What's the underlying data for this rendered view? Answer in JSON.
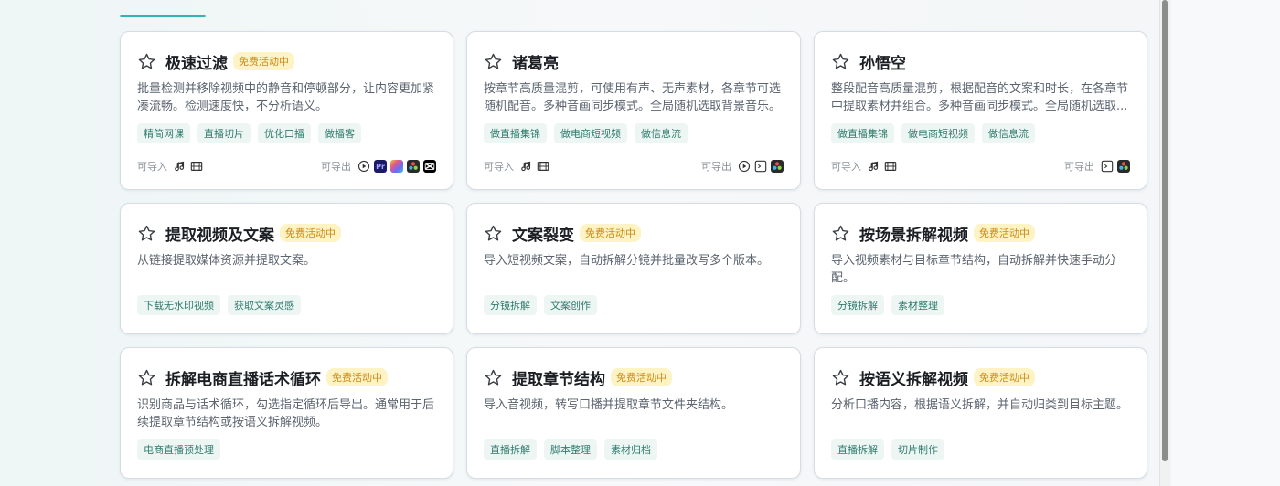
{
  "cards": [
    {
      "title": "极速过滤",
      "badge": "免费活动中",
      "desc": "批量检测并移除视频中的静音和停顿部分，让内容更加紧凑流畅。检测速度快，不分析语义。",
      "tags": [
        "精简网课",
        "直播切片",
        "优化口播",
        "做播客"
      ],
      "import_label": "可导入",
      "export_label": "可导出",
      "import_icons": [
        "music-note-icon",
        "film-icon"
      ],
      "export_icons": [
        "play-circle-icon",
        "premiere-pro-icon",
        "final-cut-icon",
        "davinci-resolve-icon",
        "capcut-icon"
      ]
    },
    {
      "title": "诸葛亮",
      "badge": "",
      "desc": "按章节高质量混剪，可使用有声、无声素材，各章节可选随机配音。多种音画同步模式。全局随机选取背景音乐。",
      "tags": [
        "做直播集锦",
        "做电商短视频",
        "做信息流"
      ],
      "import_label": "可导入",
      "export_label": "可导出",
      "import_icons": [
        "music-note-icon",
        "film-icon"
      ],
      "export_icons": [
        "play-circle-icon",
        "jianying-icon",
        "davinci-resolve-icon"
      ]
    },
    {
      "title": "孙悟空",
      "badge": "",
      "desc": "整段配音高质量混剪，根据配音的文案和时长，在各章节中提取素材并组合。多种音画同步模式。全局随机选取...",
      "tags": [
        "做直播集锦",
        "做电商短视频",
        "做信息流"
      ],
      "import_label": "可导入",
      "export_label": "可导出",
      "import_icons": [
        "music-note-icon",
        "film-icon"
      ],
      "export_icons": [
        "jianying-icon",
        "davinci-resolve-icon"
      ]
    },
    {
      "title": "提取视频及文案",
      "badge": "免费活动中",
      "desc": "从链接提取媒体资源并提取文案。",
      "tags": [
        "下载无水印视频",
        "获取文案灵感"
      ]
    },
    {
      "title": "文案裂变",
      "badge": "免费活动中",
      "desc": "导入短视频文案，自动拆解分镜并批量改写多个版本。",
      "tags": [
        "分镜拆解",
        "文案创作"
      ]
    },
    {
      "title": "按场景拆解视频",
      "badge": "免费活动中",
      "desc": "导入视频素材与目标章节结构，自动拆解并快速手动分配。",
      "tags": [
        "分镜拆解",
        "素材整理"
      ]
    },
    {
      "title": "拆解电商直播话术循环",
      "badge": "免费活动中",
      "desc": "识别商品与话术循环，勾选指定循环后导出。通常用于后续提取章节结构或按语义拆解视频。",
      "tags": [
        "电商直播预处理"
      ]
    },
    {
      "title": "提取章节结构",
      "badge": "免费活动中",
      "desc": "导入音视频，转写口播并提取章节文件夹结构。",
      "tags": [
        "直播拆解",
        "脚本整理",
        "素材归档"
      ]
    },
    {
      "title": "按语义拆解视频",
      "badge": "免费活动中",
      "desc": "分析口播内容，根据语义拆解，并自动归类到目标主题。",
      "tags": [
        "直播拆解",
        "切片制作"
      ]
    }
  ],
  "colors": {
    "accent": "#34b3b4",
    "badge_text": "#d08a12",
    "badge_bg": "#fdf3c4",
    "tag_text": "#2f7b6d",
    "tag_bg": "#eef6f4"
  }
}
